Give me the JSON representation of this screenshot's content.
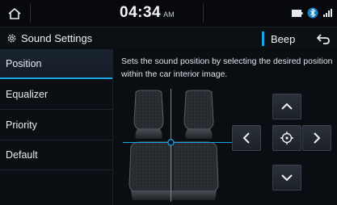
{
  "status": {
    "time": "04:34",
    "ampm": "AM"
  },
  "header": {
    "title": "Sound Settings",
    "beep_label": "Beep"
  },
  "sidebar": {
    "items": [
      {
        "label": "Position",
        "active": true
      },
      {
        "label": "Equalizer",
        "active": false
      },
      {
        "label": "Priority",
        "active": false
      },
      {
        "label": "Default",
        "active": false
      }
    ]
  },
  "main": {
    "description": "Sets the sound position by selecting the desired position within the car interior image."
  },
  "icons": [
    "home-icon",
    "battery-icon",
    "bluetooth-icon",
    "signal-icon",
    "gear-icon",
    "back-icon",
    "chevron-up-icon",
    "chevron-down-icon",
    "chevron-left-icon",
    "chevron-right-icon",
    "center-target-icon"
  ],
  "colors": {
    "accent": "#1aa6e6",
    "background": "#0a0d12"
  }
}
